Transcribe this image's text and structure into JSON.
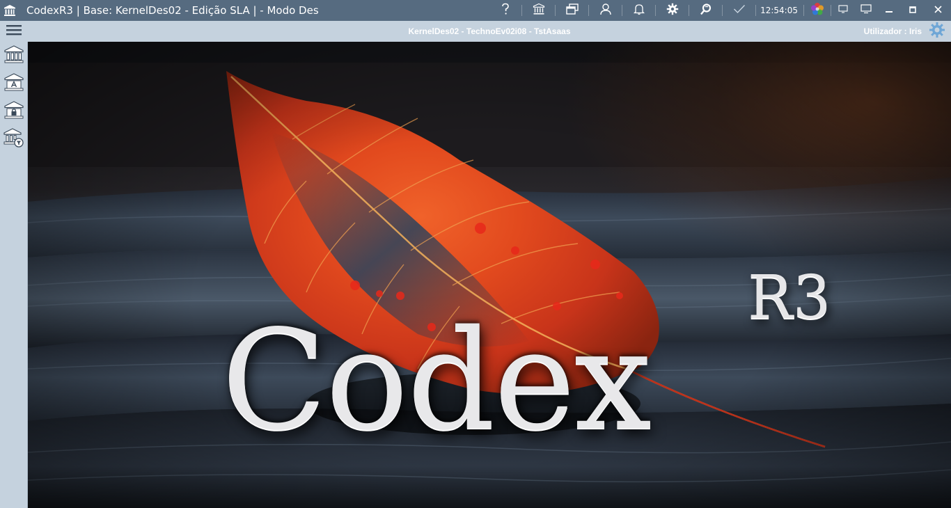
{
  "window": {
    "title": "CodexR3 | Base: KernelDes02 - Edição SLA | - Modo Des",
    "clock": "12:54:05",
    "toolbar_icons": [
      "help-icon",
      "bank-icon",
      "windows-icon",
      "user-icon",
      "bell-icon",
      "gear-icon",
      "search-refresh-icon",
      "check-icon",
      "app-logo-icon",
      "display-icon",
      "monitor-icon"
    ],
    "window_controls": [
      "minimize",
      "maximize",
      "close"
    ]
  },
  "header": {
    "context": "KernelDes02 - TechnoEv02i08 - TstAsaas",
    "user_label": "Utilizador : Iris"
  },
  "sidebar": {
    "items": [
      {
        "icon": "bank-icon"
      },
      {
        "icon": "bank-document-icon"
      },
      {
        "icon": "bank-lock-icon"
      },
      {
        "icon": "bank-filter-icon"
      }
    ]
  },
  "splash": {
    "brand": "Codex",
    "brand_sup": "R3"
  },
  "colors": {
    "titlebar": "#566b80",
    "subbar": "#c5d2de",
    "leaf": "#e0401a"
  }
}
